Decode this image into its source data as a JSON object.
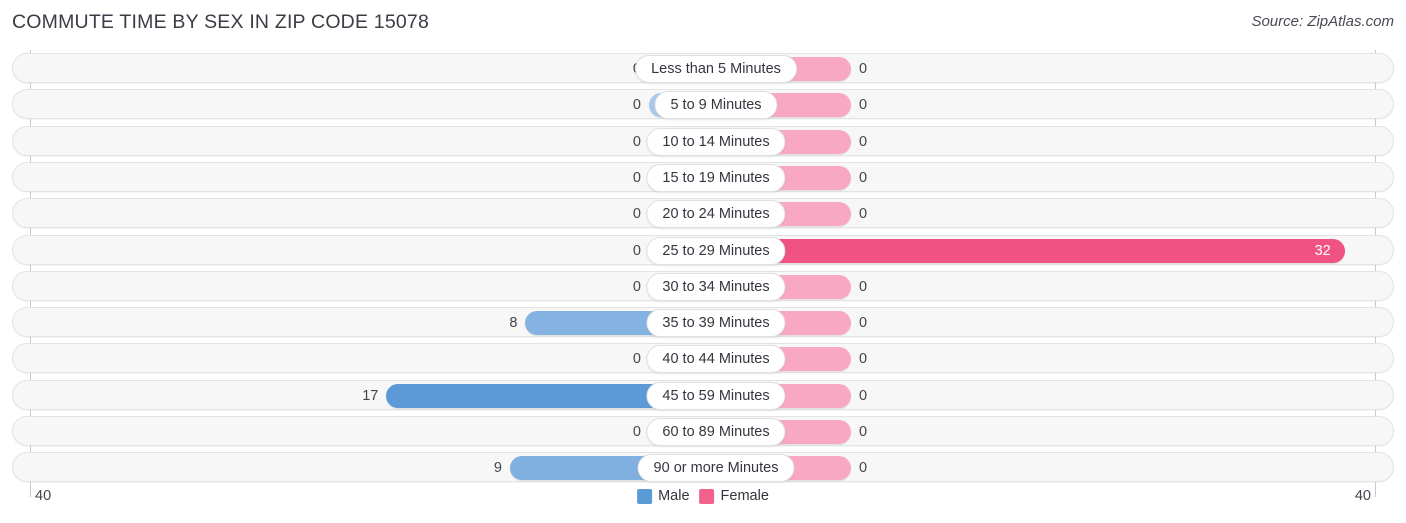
{
  "header": {
    "title": "COMMUTE TIME BY SEX IN ZIP CODE 15078",
    "source": "Source: ZipAtlas.com"
  },
  "axis": {
    "left_tick": "40",
    "right_tick": "40"
  },
  "legend": {
    "items": [
      {
        "label": "Male",
        "color": "#5b9bd5"
      },
      {
        "label": "Female",
        "color": "#f2608c"
      }
    ]
  },
  "chart_data": {
    "type": "bar",
    "orientation": "horizontal-diverging",
    "title": "COMMUTE TIME BY SEX IN ZIP CODE 15078",
    "xlabel": "",
    "ylabel": "",
    "xlim": [
      40,
      40
    ],
    "axis_max": 40,
    "grid": false,
    "legend_position": "bottom-center",
    "categories": [
      "Less than 5 Minutes",
      "5 to 9 Minutes",
      "10 to 14 Minutes",
      "15 to 19 Minutes",
      "20 to 24 Minutes",
      "25 to 29 Minutes",
      "30 to 34 Minutes",
      "35 to 39 Minutes",
      "40 to 44 Minutes",
      "45 to 59 Minutes",
      "60 to 89 Minutes",
      "90 or more Minutes"
    ],
    "series": [
      {
        "name": "Male",
        "color": "#5b9bd5",
        "values": [
          0,
          0,
          0,
          0,
          0,
          0,
          0,
          8,
          0,
          17,
          0,
          9
        ],
        "labels": [
          "0",
          "0",
          "0",
          "0",
          "0",
          "0",
          "0",
          "8",
          "0",
          "17",
          "0",
          "9"
        ]
      },
      {
        "name": "Female",
        "color": "#f2608c",
        "values": [
          0,
          0,
          0,
          0,
          0,
          32,
          0,
          0,
          0,
          0,
          0,
          0
        ],
        "labels": [
          "0",
          "0",
          "0",
          "0",
          "0",
          "32",
          "0",
          "0",
          "0",
          "0",
          "0",
          "0"
        ]
      }
    ]
  }
}
